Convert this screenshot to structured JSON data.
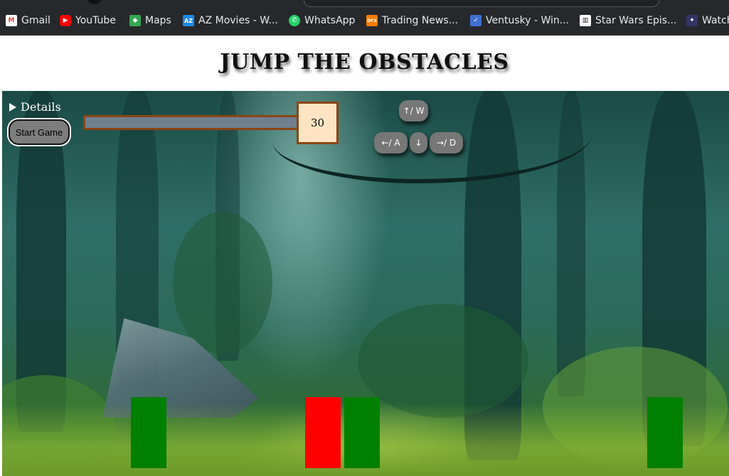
{
  "bookmarks": [
    {
      "label": "Gmail",
      "icon": "gmail-icon",
      "icon_text": "M",
      "color": "#ea4335"
    },
    {
      "label": "YouTube",
      "icon": "youtube-icon",
      "icon_text": "▶",
      "color": "#ff0000"
    },
    {
      "label": "Maps",
      "icon": "maps-icon",
      "icon_text": "◆",
      "color": "#34a853"
    },
    {
      "label": "AZ Movies - W...",
      "icon": "az-movies-icon",
      "icon_text": "AZ",
      "color": "#1e88e5"
    },
    {
      "label": "WhatsApp",
      "icon": "whatsapp-icon",
      "icon_text": "✆",
      "color": "#25d366"
    },
    {
      "label": "Trading News...",
      "icon": "dfx-icon",
      "icon_text": "DFX",
      "color": "#f57c00"
    },
    {
      "label": "Ventusky - Win...",
      "icon": "ventusky-icon",
      "icon_text": "✓",
      "color": "#3f6ecf"
    },
    {
      "label": "Star Wars Epis...",
      "icon": "archive-icon",
      "icon_text": "▥",
      "color": "#444444"
    },
    {
      "label": "Watch",
      "icon": "watch-icon",
      "icon_text": "✦",
      "color": "#333366"
    }
  ],
  "page": {
    "title": "JUMP THE OBSTACLES"
  },
  "game": {
    "details_label": "Details",
    "start_button": "Start Game",
    "timer_value": "30",
    "keys": {
      "up": "↑/ W",
      "left": "←/ A",
      "down": "↓",
      "right": "→/ D"
    },
    "colors": {
      "timer_track": "#708090",
      "timer_border": "#8b4513",
      "timer_box": "#ffe4c4",
      "player": "#ff0000",
      "obstacle": "#008000"
    }
  }
}
